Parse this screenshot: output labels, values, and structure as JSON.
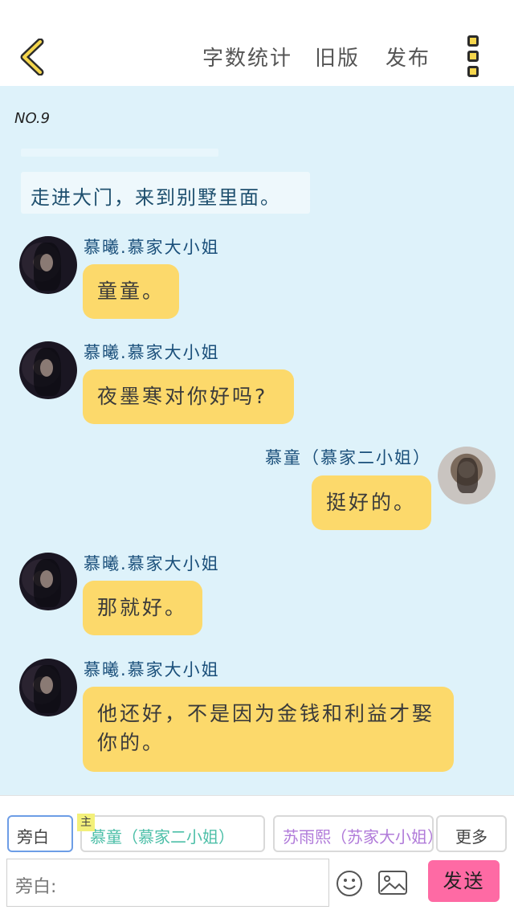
{
  "header": {
    "word_count_label": "字数统计",
    "old_version_label": "旧版",
    "publish_label": "发布"
  },
  "chat": {
    "chapter": "NO.9",
    "narration": "走进大门，来到别墅里面。",
    "messages": [
      {
        "sender": "慕曦.慕家大小姐",
        "text": "童童。"
      },
      {
        "sender": "慕曦.慕家大小姐",
        "text": "夜墨寒对你好吗?"
      },
      {
        "sender": "慕童（慕家二小姐）",
        "text": "挺好的。"
      },
      {
        "sender": "慕曦.慕家大小姐",
        "text": "那就好。"
      },
      {
        "sender": "慕曦.慕家大小姐",
        "text": "他还好，不是因为金钱和利益才娶你的。"
      }
    ]
  },
  "bottom": {
    "roles": [
      "旁白",
      "慕童（慕家二小姐）",
      "苏雨熙（苏家大小姐）",
      "更多"
    ],
    "main_tag": "主",
    "input_placeholder": "旁白:",
    "send_label": "发送"
  },
  "colors": {
    "chat_background": "#def2fa",
    "bubble": "#fcd96b",
    "send_button": "#fe6aa4",
    "name_text": "#1a4f7a"
  },
  "icons": [
    "back-arrow-icon",
    "more-vertical-icon",
    "emoji-icon",
    "image-icon"
  ]
}
